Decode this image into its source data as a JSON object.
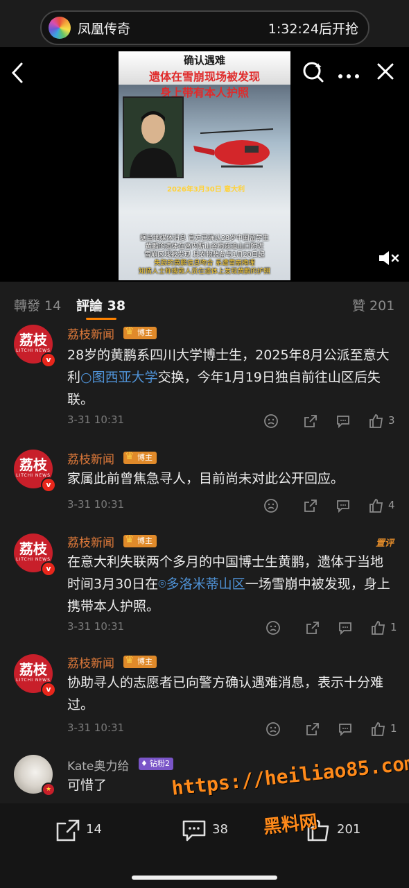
{
  "top_bar": {
    "app_name": "凤凰传奇",
    "countdown": "1:32:24后开抢"
  },
  "video": {
    "title_line1": "确认遇难",
    "title_line2": "遗体在雪崩现场被发现",
    "title_line3": "身上带有本人护照",
    "date_stamp": "2026年3月30日 意大利",
    "caption_lines": [
      "据当地媒体消息 官方已确认28岁中国留学生",
      "黄鹏的遗体在高内斯山谷梅兹迪山口附近",
      "雪崩区域被发现 其衣物装备与1月20日起",
      "失踪的黄鹏信息吻合 系遭雪崩掩埋",
      "知情人士称搜救人员在遗体上发现黄鹏的护照"
    ]
  },
  "tabs": {
    "repost": "轉發 14",
    "comments": "評論 38",
    "likes": "贊 201"
  },
  "comments": [
    {
      "avatar_text": "荔枝",
      "avatar_sub": "LITCHI NEWS",
      "user": "荔枝新闻",
      "badge": "博主",
      "text_before": "28岁的黄鹏系四川大学博士生，2025年8月公派至意大利",
      "link": "图西亚大学",
      "text_after": "交换，今年1月19日独自前往山区后失联。",
      "time": "3-31 10:31",
      "likes": "3"
    },
    {
      "avatar_text": "荔枝",
      "avatar_sub": "LITCHI NEWS",
      "user": "荔枝新闻",
      "badge": "博主",
      "text": "家属此前曾焦急寻人，目前尚未对此公开回应。",
      "time": "3-31 10:31",
      "likes": "4"
    },
    {
      "avatar_text": "荔枝",
      "avatar_sub": "LITCHI NEWS",
      "user": "荔枝新闻",
      "badge": "博主",
      "pinned": "置评",
      "text_before": "在意大利失联两个多月的中国博士生黄鹏，遗体于当地时间3月30日在",
      "link": "多洛米蒂山区",
      "text_after": "一场雪崩中被发现，身上携带本人护照。",
      "time": "3-31 10:31",
      "likes": "1"
    },
    {
      "avatar_text": "荔枝",
      "avatar_sub": "LITCHI NEWS",
      "user": "荔枝新闻",
      "badge": "博主",
      "text": "协助寻人的志愿者已向警方确认遇难消息，表示十分难过。",
      "time": "3-31 10:31",
      "likes": "1"
    },
    {
      "user": "Kate奥力给",
      "badge": "钻粉2",
      "text": "可惜了"
    }
  ],
  "bottom_bar": {
    "repost_count": "14",
    "comment_count": "38",
    "like_count": "201"
  },
  "watermark": {
    "url": "https://heiliao85.com",
    "name": "黑料网"
  },
  "colors": {
    "accent": "#ff8200",
    "username": "#e07a3a",
    "link": "#4f93d8",
    "brand_red": "#c81f2a"
  }
}
